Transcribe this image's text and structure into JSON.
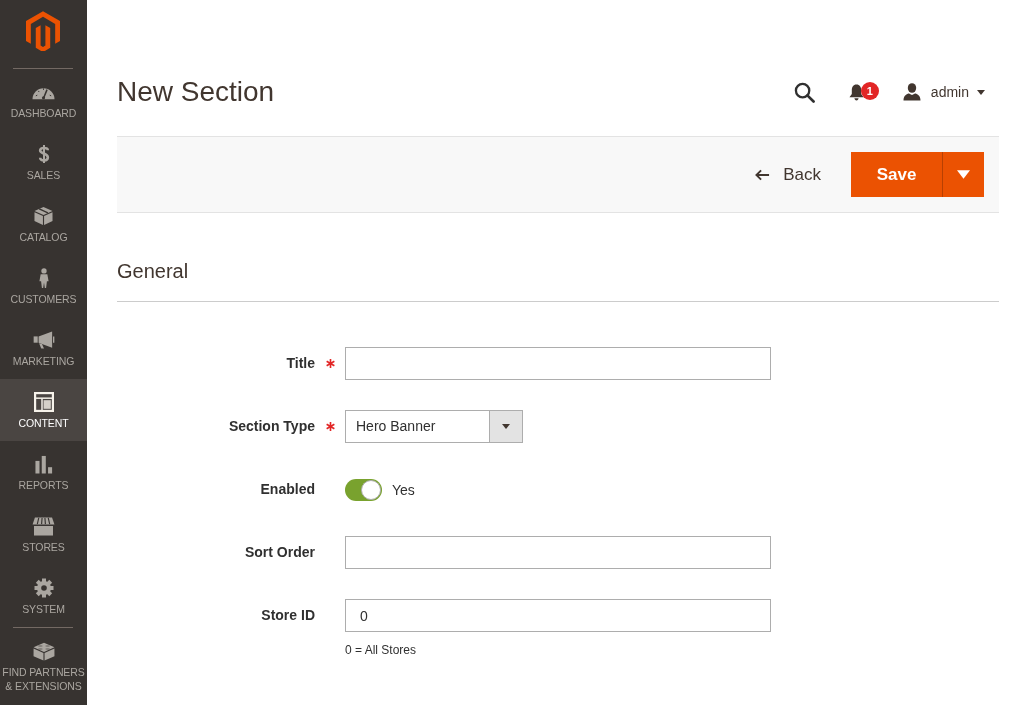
{
  "sidebar": {
    "items": [
      {
        "label": "DASHBOARD",
        "selected": false
      },
      {
        "label": "SALES",
        "selected": false
      },
      {
        "label": "CATALOG",
        "selected": false
      },
      {
        "label": "CUSTOMERS",
        "selected": false
      },
      {
        "label": "MARKETING",
        "selected": false
      },
      {
        "label": "CONTENT",
        "selected": true
      },
      {
        "label": "REPORTS",
        "selected": false
      },
      {
        "label": "STORES",
        "selected": false
      },
      {
        "label": "SYSTEM",
        "selected": false
      },
      {
        "label": "FIND PARTNERS & EXTENSIONS",
        "selected": false
      }
    ]
  },
  "header": {
    "title": "New Section",
    "notifications": "1",
    "user": "admin"
  },
  "actions": {
    "back": "Back",
    "save": "Save"
  },
  "section": {
    "title": "General"
  },
  "form": {
    "fields": [
      {
        "kind": "text",
        "label": "Title",
        "required": true
      },
      {
        "kind": "select",
        "label": "Section Type",
        "required": true,
        "value": "Hero Banner"
      },
      {
        "kind": "toggle",
        "label": "Enabled",
        "required": false,
        "on": true,
        "value": "Yes"
      },
      {
        "kind": "text",
        "label": "Sort Order",
        "required": false
      },
      {
        "kind": "text",
        "label": "Store ID",
        "required": false,
        "value": "0",
        "note": "0 = All Stores"
      }
    ]
  }
}
